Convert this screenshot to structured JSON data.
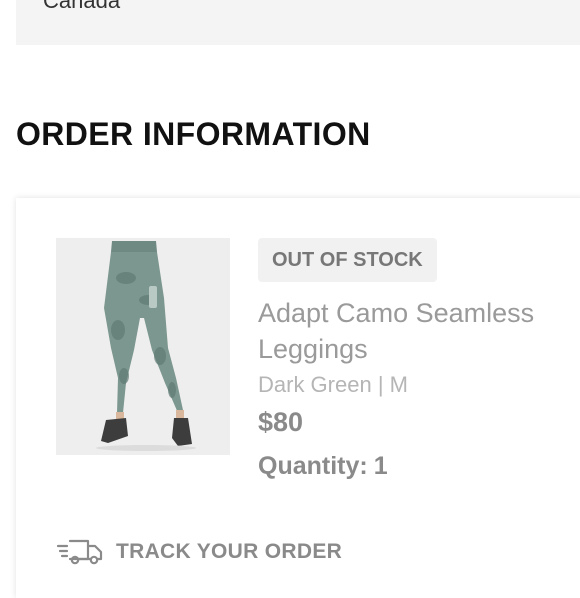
{
  "shipping_address": {
    "country": "Canada"
  },
  "section": {
    "title": "ORDER INFORMATION"
  },
  "order_item": {
    "status_badge": "OUT OF STOCK",
    "name": "Adapt Camo Seamless Leggings",
    "variant": "Dark Green | M",
    "price": "$80",
    "quantity_label": "Quantity:",
    "quantity_value": "1",
    "image_icon": "leggings-product-photo"
  },
  "actions": {
    "track_order_label": "TRACK YOUR ORDER",
    "track_icon": "delivery-truck-icon"
  }
}
